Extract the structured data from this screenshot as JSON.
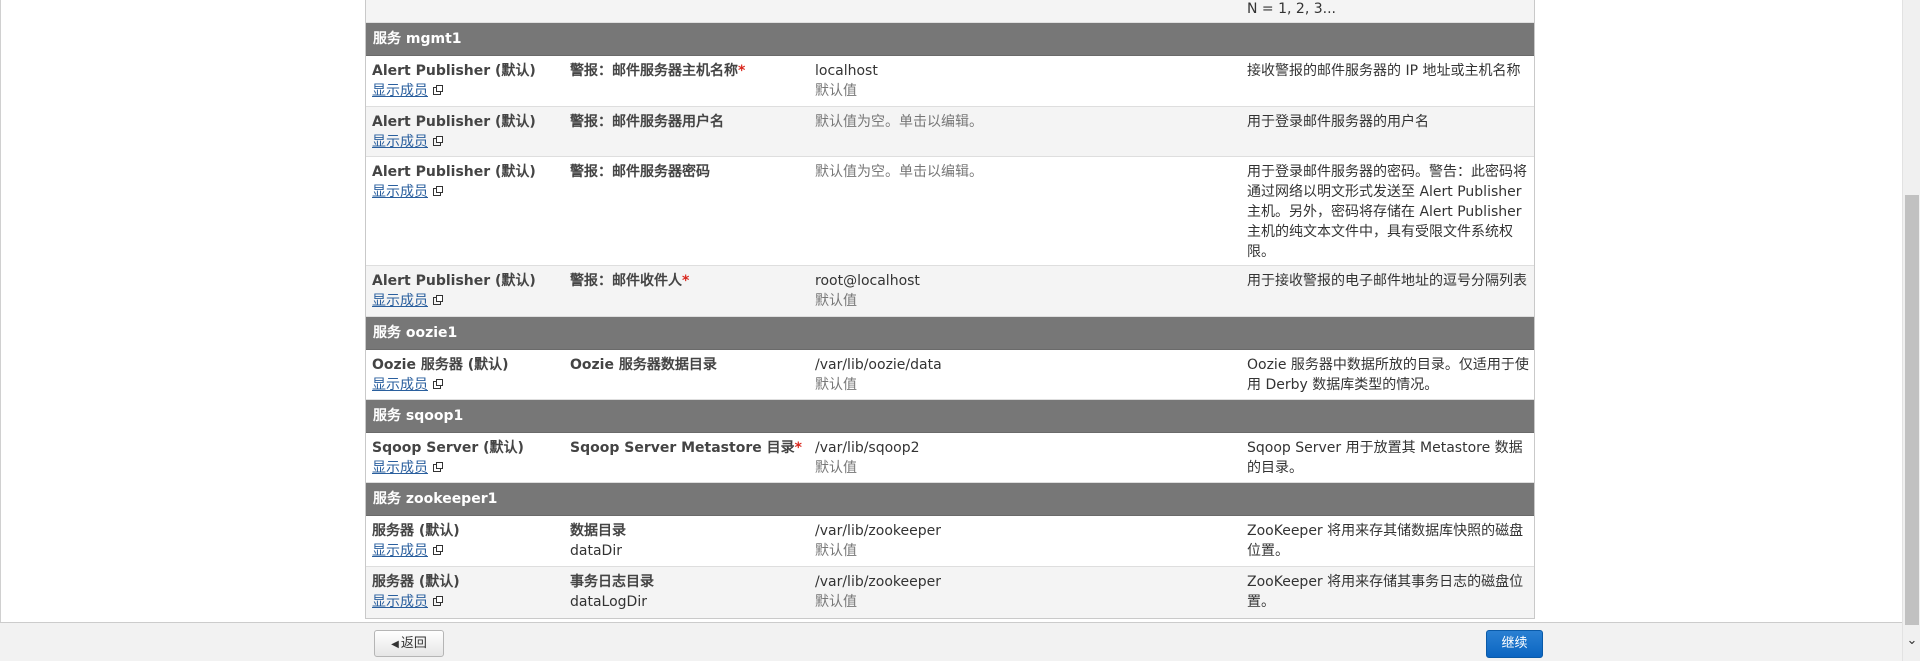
{
  "top_stub": {
    "desc": "N = 1, 2, 3..."
  },
  "show_members_label": "显示成员",
  "default_label": "默认值",
  "sections": [
    {
      "title": "服务 mgmt1",
      "rows": [
        {
          "role": "Alert Publisher (默认)",
          "name": "警报：邮件服务器主机名称",
          "required": "*",
          "value": "localhost",
          "value_note": "默认值",
          "desc": "接收警报的邮件服务器的 IP 地址或主机名称"
        },
        {
          "role": "Alert Publisher (默认)",
          "name": "警报：邮件服务器用户名",
          "required": "",
          "value": "默认值为空。单击以编辑。",
          "value_note": "",
          "desc": "用于登录邮件服务器的用户名"
        },
        {
          "role": "Alert Publisher (默认)",
          "name": "警报：邮件服务器密码",
          "required": "",
          "value": "默认值为空。单击以编辑。",
          "value_note": "",
          "desc": "用于登录邮件服务器的密码。警告：此密码将通过网络以明文形式发送至 Alert Publisher 主机。另外，密码将存储在 Alert Publisher 主机的纯文本文件中，具有受限文件系统权限。"
        },
        {
          "role": "Alert Publisher (默认)",
          "name": "警报：邮件收件人",
          "required": "*",
          "value": "root@localhost",
          "value_note": "默认值",
          "desc": "用于接收警报的电子邮件地址的逗号分隔列表"
        }
      ]
    },
    {
      "title": "服务 oozie1",
      "rows": [
        {
          "role": "Oozie 服务器 (默认)",
          "name": "Oozie 服务器数据目录",
          "required": "",
          "value": "/var/lib/oozie/data",
          "value_note": "默认值",
          "desc": "Oozie 服务器中数据所放的目录。仅适用于使用 Derby 数据库类型的情况。"
        }
      ]
    },
    {
      "title": "服务 sqoop1",
      "rows": [
        {
          "role": "Sqoop Server (默认)",
          "name": "Sqoop Server Metastore 目录",
          "required": "*",
          "value": "/var/lib/sqoop2",
          "value_note": "默认值",
          "desc": "Sqoop Server 用于放置其 Metastore 数据的目录。"
        }
      ]
    },
    {
      "title": "服务 zookeeper1",
      "rows": [
        {
          "role": "服务器 (默认)",
          "name": "数据目录",
          "key": "dataDir",
          "required": "",
          "value": "/var/lib/zookeeper",
          "value_note": "默认值",
          "desc": "ZooKeeper 将用来存其储数据库快照的磁盘位置。"
        },
        {
          "role": "服务器 (默认)",
          "name": "事务日志目录",
          "key": "dataLogDir",
          "required": "",
          "value": "/var/lib/zookeeper",
          "value_note": "默认值",
          "desc": "ZooKeeper 将用来存储其事务日志的磁盘位置。"
        }
      ]
    }
  ],
  "footer": {
    "back_label": "返回",
    "continue_label": "继续"
  },
  "icons": {
    "back": "skip-back-icon",
    "external_link": "external-link-icon",
    "scroll_down": "chevron-down-icon"
  },
  "colors": {
    "section_header_bg": "#777777",
    "link": "#2a5f9e",
    "required": "#d9261c",
    "primary_button": "#0b65c2"
  }
}
